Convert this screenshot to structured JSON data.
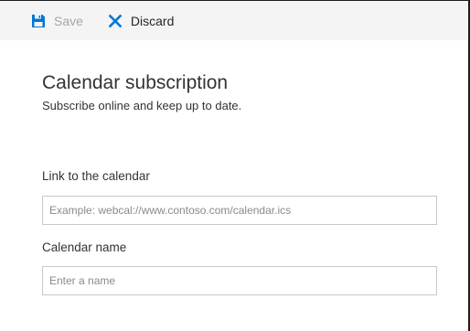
{
  "toolbar": {
    "save_label": "Save",
    "discard_label": "Discard",
    "save_icon": "floppy-disk-icon",
    "discard_icon": "close-x-icon",
    "accent_color": "#0078d4",
    "disabled_text_color": "#a6a6a6"
  },
  "form": {
    "title": "Calendar subscription",
    "subtitle": "Subscribe online and keep up to date.",
    "link_field": {
      "label": "Link to the calendar",
      "placeholder": "Example: webcal://www.contoso.com/calendar.ics",
      "value": ""
    },
    "name_field": {
      "label": "Calendar name",
      "placeholder": "Enter a name",
      "value": ""
    }
  }
}
